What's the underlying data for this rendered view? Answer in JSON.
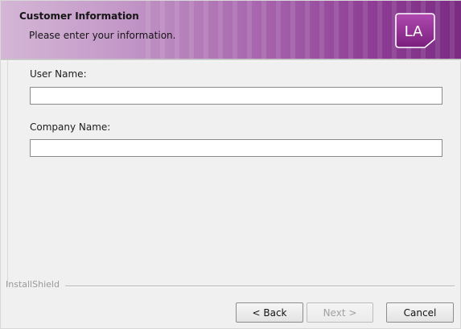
{
  "header": {
    "title": "Customer Information",
    "subtitle": "Please enter your information.",
    "logo_text": "LA",
    "logo_color": "#8e2a8f"
  },
  "form": {
    "user_name": {
      "label": "User Name:",
      "value": ""
    },
    "company_name": {
      "label": "Company Name:",
      "value": ""
    }
  },
  "footer": {
    "brand": "InstallShield",
    "buttons": {
      "back": "< Back",
      "next": "Next >",
      "cancel": "Cancel"
    },
    "next_enabled": false
  }
}
